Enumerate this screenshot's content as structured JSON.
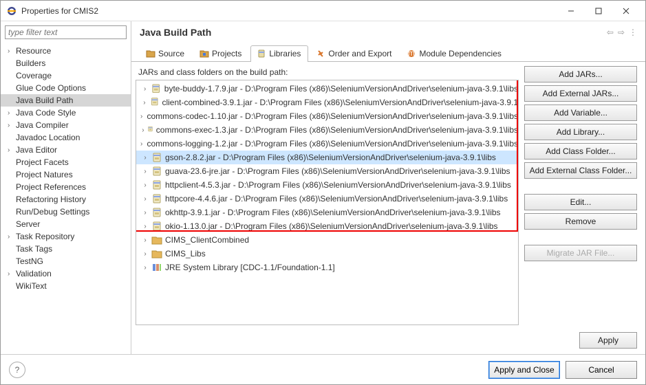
{
  "window": {
    "title": "Properties for CMIS2"
  },
  "filter": {
    "placeholder": "type filter text"
  },
  "sidebar": {
    "items": [
      {
        "label": "Resource",
        "chev": true
      },
      {
        "label": "Builders",
        "chev": false
      },
      {
        "label": "Coverage",
        "chev": false
      },
      {
        "label": "Glue Code Options",
        "chev": false
      },
      {
        "label": "Java Build Path",
        "chev": false,
        "selected": true
      },
      {
        "label": "Java Code Style",
        "chev": true
      },
      {
        "label": "Java Compiler",
        "chev": true
      },
      {
        "label": "Javadoc Location",
        "chev": false
      },
      {
        "label": "Java Editor",
        "chev": true
      },
      {
        "label": "Project Facets",
        "chev": false
      },
      {
        "label": "Project Natures",
        "chev": false
      },
      {
        "label": "Project References",
        "chev": false
      },
      {
        "label": "Refactoring History",
        "chev": false
      },
      {
        "label": "Run/Debug Settings",
        "chev": false
      },
      {
        "label": "Server",
        "chev": false
      },
      {
        "label": "Task Repository",
        "chev": true
      },
      {
        "label": "Task Tags",
        "chev": false
      },
      {
        "label": "TestNG",
        "chev": false
      },
      {
        "label": "Validation",
        "chev": true
      },
      {
        "label": "WikiText",
        "chev": false
      }
    ]
  },
  "header": {
    "title": "Java Build Path"
  },
  "tabs": [
    {
      "label": "Source",
      "icon": "folder-source"
    },
    {
      "label": "Projects",
      "icon": "folder-project"
    },
    {
      "label": "Libraries",
      "icon": "jar",
      "active": true
    },
    {
      "label": "Order and Export",
      "icon": "order"
    },
    {
      "label": "Module Dependencies",
      "icon": "module"
    }
  ],
  "jars": {
    "label": "JARs and class folders on the build path:",
    "items": [
      {
        "kind": "jar",
        "label": "byte-buddy-1.7.9.jar - D:\\Program Files (x86)\\SeleniumVersionAndDriver\\selenium-java-3.9.1\\libs"
      },
      {
        "kind": "jar",
        "label": "client-combined-3.9.1.jar - D:\\Program Files (x86)\\SeleniumVersionAndDriver\\selenium-java-3.9.1"
      },
      {
        "kind": "jar",
        "label": "commons-codec-1.10.jar - D:\\Program Files (x86)\\SeleniumVersionAndDriver\\selenium-java-3.9.1\\libs"
      },
      {
        "kind": "jar",
        "label": "commons-exec-1.3.jar - D:\\Program Files (x86)\\SeleniumVersionAndDriver\\selenium-java-3.9.1\\libs"
      },
      {
        "kind": "jar",
        "label": "commons-logging-1.2.jar - D:\\Program Files (x86)\\SeleniumVersionAndDriver\\selenium-java-3.9.1\\libs"
      },
      {
        "kind": "jar",
        "label": "gson-2.8.2.jar - D:\\Program Files (x86)\\SeleniumVersionAndDriver\\selenium-java-3.9.1\\libs",
        "selected": true
      },
      {
        "kind": "jar",
        "label": "guava-23.6-jre.jar - D:\\Program Files (x86)\\SeleniumVersionAndDriver\\selenium-java-3.9.1\\libs"
      },
      {
        "kind": "jar",
        "label": "httpclient-4.5.3.jar - D:\\Program Files (x86)\\SeleniumVersionAndDriver\\selenium-java-3.9.1\\libs"
      },
      {
        "kind": "jar",
        "label": "httpcore-4.4.6.jar - D:\\Program Files (x86)\\SeleniumVersionAndDriver\\selenium-java-3.9.1\\libs"
      },
      {
        "kind": "jar",
        "label": "okhttp-3.9.1.jar - D:\\Program Files (x86)\\SeleniumVersionAndDriver\\selenium-java-3.9.1\\libs"
      },
      {
        "kind": "jar",
        "label": "okio-1.13.0.jar - D:\\Program Files (x86)\\SeleniumVersionAndDriver\\selenium-java-3.9.1\\libs"
      },
      {
        "kind": "folder",
        "label": "CIMS_ClientCombined"
      },
      {
        "kind": "folder",
        "label": "CIMS_Libs"
      },
      {
        "kind": "lib",
        "label": "JRE System Library [CDC-1.1/Foundation-1.1]"
      }
    ]
  },
  "buttons": {
    "addJars": "Add JARs...",
    "addExtJars": "Add External JARs...",
    "addVar": "Add Variable...",
    "addLib": "Add Library...",
    "addCF": "Add Class Folder...",
    "addExtCF": "Add External Class Folder...",
    "edit": "Edit...",
    "remove": "Remove",
    "migrate": "Migrate JAR File...",
    "apply": "Apply",
    "applyClose": "Apply and Close",
    "cancel": "Cancel"
  }
}
